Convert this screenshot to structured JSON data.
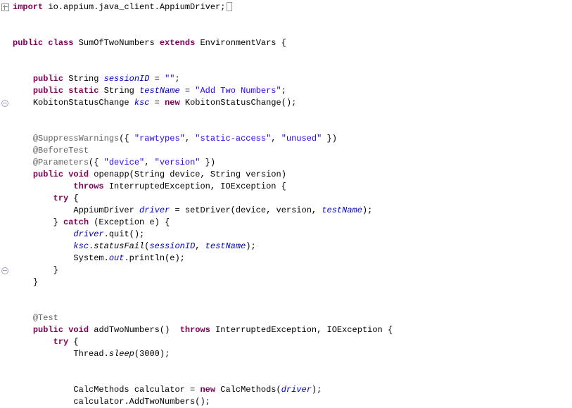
{
  "line0": {
    "kw_import": "import",
    "pkg": " io.appium.java_client.AppiumDriver;"
  },
  "line2": {
    "kw_public": "public",
    "kw_class": "class",
    "class_name": " SumOfTwoNumbers ",
    "kw_extends": "extends",
    "super_name": " EnvironmentVars {"
  },
  "line4": {
    "kw_public": "public",
    "type": " String ",
    "field": "sessionID",
    "rest": " = ",
    "str": "\"\"",
    "semi": ";"
  },
  "line5": {
    "kw_public": "public",
    "kw_static": "static",
    "type": " String ",
    "field": "testName",
    "rest": " = ",
    "str": "\"Add Two Numbers\"",
    "semi": ";"
  },
  "line6": {
    "type1": "KobitonStatusChange ",
    "var": "ksc",
    "eq": " = ",
    "kw_new": "new",
    "type2": " KobitonStatusChange();"
  },
  "line8": {
    "ann": "@SuppressWarnings",
    "paren1": "({ ",
    "s1": "\"rawtypes\"",
    "c1": ", ",
    "s2": "\"static-access\"",
    "c2": ", ",
    "s3": "\"unused\"",
    "paren2": " })"
  },
  "line9": {
    "ann": "@BeforeTest"
  },
  "line10": {
    "ann": "@Parameters",
    "paren1": "({ ",
    "s1": "\"device\"",
    "c1": ", ",
    "s2": "\"version\"",
    "paren2": " })"
  },
  "line11": {
    "kw_public": "public",
    "kw_void": "void",
    "method": " openapp",
    "sig": "(String device, String version)"
  },
  "line12": {
    "kw_throws": "throws",
    "exc": " InterruptedException, IOException {"
  },
  "line13": {
    "kw_try": "try",
    " brace": " {"
  },
  "line14": {
    "type": "AppiumDriver ",
    "var": "driver",
    "eq": " = setDriver(device, version, ",
    "field": "testName",
    "end": ");"
  },
  "line15": {
    "close": "} ",
    "kw_catch": "catch",
    "rest": " (Exception e) {"
  },
  "line16": {
    "obj": "driver",
    "call": ".quit();"
  },
  "line17": {
    "obj": "ksc",
    "dot": ".",
    "method": "statusFail",
    "open": "(",
    "arg1": "sessionID",
    "c": ", ",
    "arg2": "testName",
    "close": ");"
  },
  "line18": {
    "sys": "System.",
    "out": "out",
    "call": ".println(e);"
  },
  "line19": {
    "close": "}"
  },
  "line20": {
    "close": "}"
  },
  "line22": {
    "ann": "@Test"
  },
  "line23": {
    "kw_public": "public",
    "kw_void": "void",
    "method": " addTwoNumbers",
    "sig": "()  ",
    "kw_throws": "throws",
    "exc": " InterruptedException, IOException {"
  },
  "line24": {
    "kw_try": "try",
    "brace": " {"
  },
  "line25": {
    "thr": "Thread.",
    "sleep": "sleep",
    "args": "(3000);"
  },
  "line27": {
    "type": "CalcMethods ",
    "var": "calculator",
    "eq": " = ",
    "kw_new": "new",
    "ctor": " CalcMethods(",
    "arg": "driver",
    "close": ");"
  },
  "line28": {
    "obj": "calculator",
    "call": ".AddTwoNumbers();"
  }
}
